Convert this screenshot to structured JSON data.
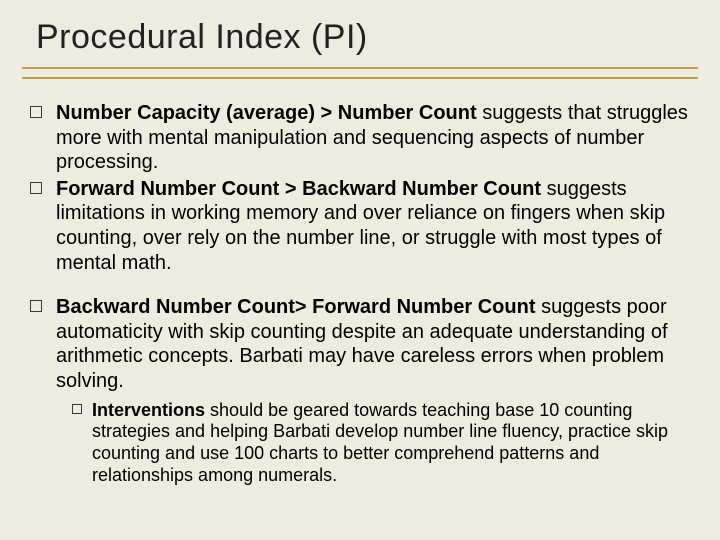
{
  "title": "Procedural Index (PI)",
  "bullets": [
    {
      "bold": "Number Capacity (average) > Number Count ",
      "rest": "suggests that struggles more with mental manipulation and sequencing aspects of number processing."
    },
    {
      "bold": "Forward Number Count > Backward Number Count ",
      "rest": "suggests limitations in working memory and over reliance on fingers when skip counting, over rely on the number line,  or struggle with most types of mental math."
    },
    {
      "bold": "Backward Number Count> Forward Number Count ",
      "rest": "suggests poor automaticity with skip counting despite an adequate understanding of arithmetic concepts. Barbati may have careless errors when problem solving."
    }
  ],
  "sub": {
    "bold": "Interventions ",
    "rest": "should be geared towards teaching base 10 counting strategies and helping Barbati develop number line fluency, practice skip counting and use 100 charts to better comprehend patterns and relationships among numerals."
  }
}
